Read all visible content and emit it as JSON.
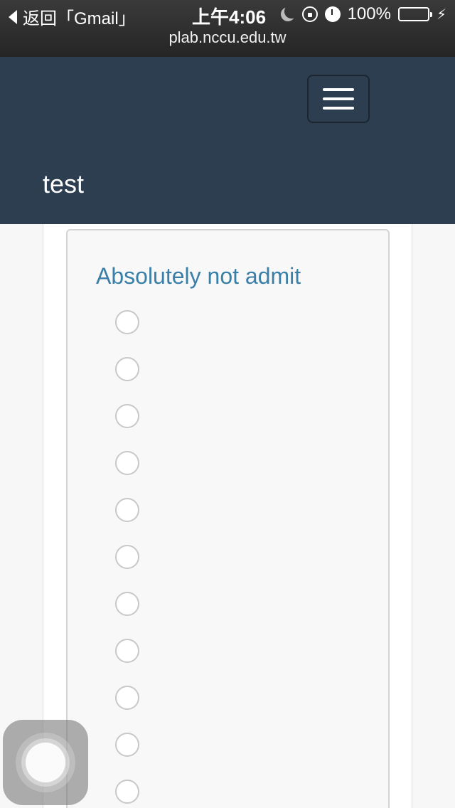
{
  "status_bar": {
    "back_label": "返回「Gmail」",
    "time": "上午4:06",
    "battery": "100%",
    "url": "plab.nccu.edu.tw",
    "icons": [
      "moon-icon",
      "orientation-lock-icon",
      "alarm-icon",
      "battery-icon",
      "charging-bolt-icon"
    ]
  },
  "header": {
    "title": "test",
    "menu_icon": "hamburger-menu-icon",
    "background_color": "#2c3e50"
  },
  "question": {
    "title": "Absolutely not admit",
    "title_color": "#3a7fa8",
    "options": [
      {
        "selected": false
      },
      {
        "selected": false
      },
      {
        "selected": false
      },
      {
        "selected": false
      },
      {
        "selected": false
      },
      {
        "selected": false
      },
      {
        "selected": false
      },
      {
        "selected": false
      },
      {
        "selected": false
      },
      {
        "selected": false
      },
      {
        "selected": false
      }
    ]
  }
}
